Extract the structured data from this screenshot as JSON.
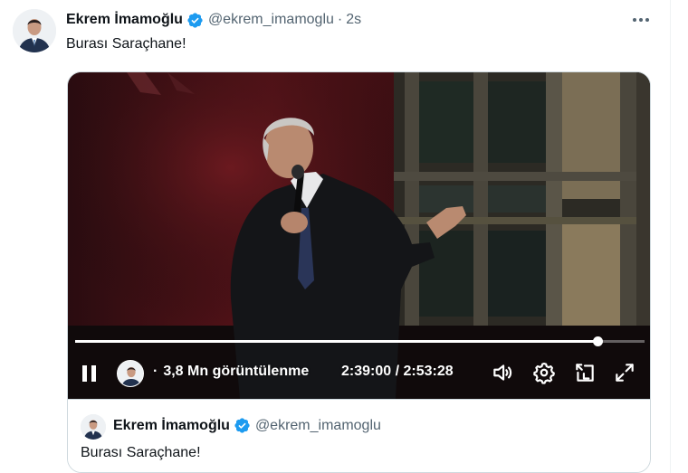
{
  "tweet": {
    "author_name": "Ekrem İmamoğlu",
    "handle": "@ekrem_imamoglu",
    "separator": "·",
    "time": "2s",
    "text": "Burası Saraçhane!",
    "verified_icon": "verified-badge-icon",
    "more_icon": "more-options-icon"
  },
  "video": {
    "views_separator": "·",
    "views": "3,8 Mn görüntülenme",
    "timecode": "2:39:00 / 2:53:28",
    "progress": 0.917,
    "icons": {
      "pause": "pause-icon",
      "volume": "volume-icon",
      "settings": "settings-icon",
      "pip": "pip-icon",
      "fullscreen": "fullscreen-icon"
    }
  },
  "quote": {
    "author_name": "Ekrem İmamoğlu",
    "handle": "@ekrem_imamoglu",
    "text": "Burası Saraçhane!"
  },
  "colors": {
    "text_primary": "#0f1419",
    "text_secondary": "#536471",
    "verified_blue": "#1d9bf0",
    "border": "#cfd9de"
  }
}
